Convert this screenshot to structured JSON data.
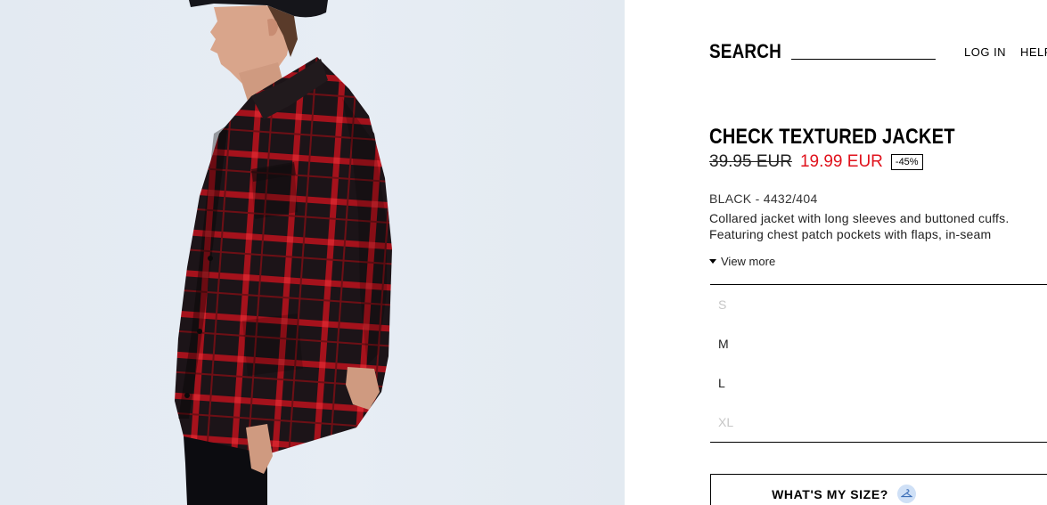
{
  "header": {
    "search_label": "SEARCH",
    "login_label": "LOG IN",
    "help_label": "HELF"
  },
  "product": {
    "name": "CHECK TEXTURED JACKET",
    "old_price": "39.95 EUR",
    "new_price": "19.99 EUR",
    "discount": "-45%",
    "color_ref": "BLACK - 4432/404",
    "description_line1": "Collared jacket with long sleeves and buttoned cuffs.",
    "description_line2": "Featuring chest patch pockets with flaps, in-seam",
    "view_more": "View more"
  },
  "sizes": [
    {
      "label": "S",
      "available": false
    },
    {
      "label": "M",
      "available": true
    },
    {
      "label": "L",
      "available": true
    },
    {
      "label": "XL",
      "available": false
    }
  ],
  "size_guide": {
    "label": "WHAT'S MY SIZE?",
    "icon": "hanger-icon"
  },
  "colors": {
    "sale_red": "#e0131d",
    "background_photo": "#e5ebf2",
    "jacket_black": "#1a1216",
    "check_red": "#b5121b"
  }
}
